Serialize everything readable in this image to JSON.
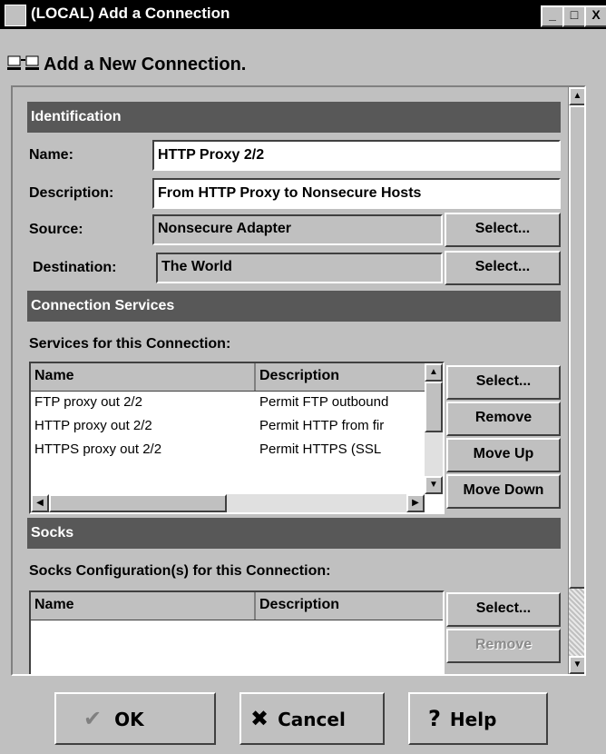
{
  "window": {
    "title": "(LOCAL) Add a Connection",
    "minimize": "_",
    "maximize": "□",
    "close": "X"
  },
  "header": {
    "title": "Add a New Connection."
  },
  "identification": {
    "heading": "Identification",
    "name_label": "Name:",
    "name_value": "HTTP Proxy 2/2",
    "description_label": "Description:",
    "description_value": "From HTTP Proxy to Nonsecure Hosts",
    "source_label": "Source:",
    "source_value": "Nonsecure Adapter",
    "source_select": "Select...",
    "destination_label": "Destination:",
    "destination_value": "The World",
    "destination_select": "Select..."
  },
  "services": {
    "heading": "Connection Services",
    "subheading": "Services for this Connection:",
    "columns": [
      "Name",
      "Description"
    ],
    "rows": [
      {
        "name": "FTP proxy out 2/2",
        "desc": "Permit FTP outbound"
      },
      {
        "name": "HTTP proxy out 2/2",
        "desc": "Permit HTTP from fir"
      },
      {
        "name": "HTTPS proxy out 2/2",
        "desc": "Permit HTTPS (SSL"
      }
    ],
    "buttons": {
      "select": "Select...",
      "remove": "Remove",
      "move_up": "Move Up",
      "move_down": "Move Down"
    }
  },
  "socks": {
    "heading": "Socks",
    "subheading": "Socks Configuration(s) for this Connection:",
    "columns": [
      "Name",
      "Description"
    ],
    "buttons": {
      "select": "Select...",
      "remove": "Remove"
    }
  },
  "footer": {
    "ok": "OK",
    "cancel": "Cancel",
    "help": "Help"
  },
  "icons": {
    "ok": "checkmark-icon",
    "cancel": "x-icon",
    "help": "question-icon"
  }
}
